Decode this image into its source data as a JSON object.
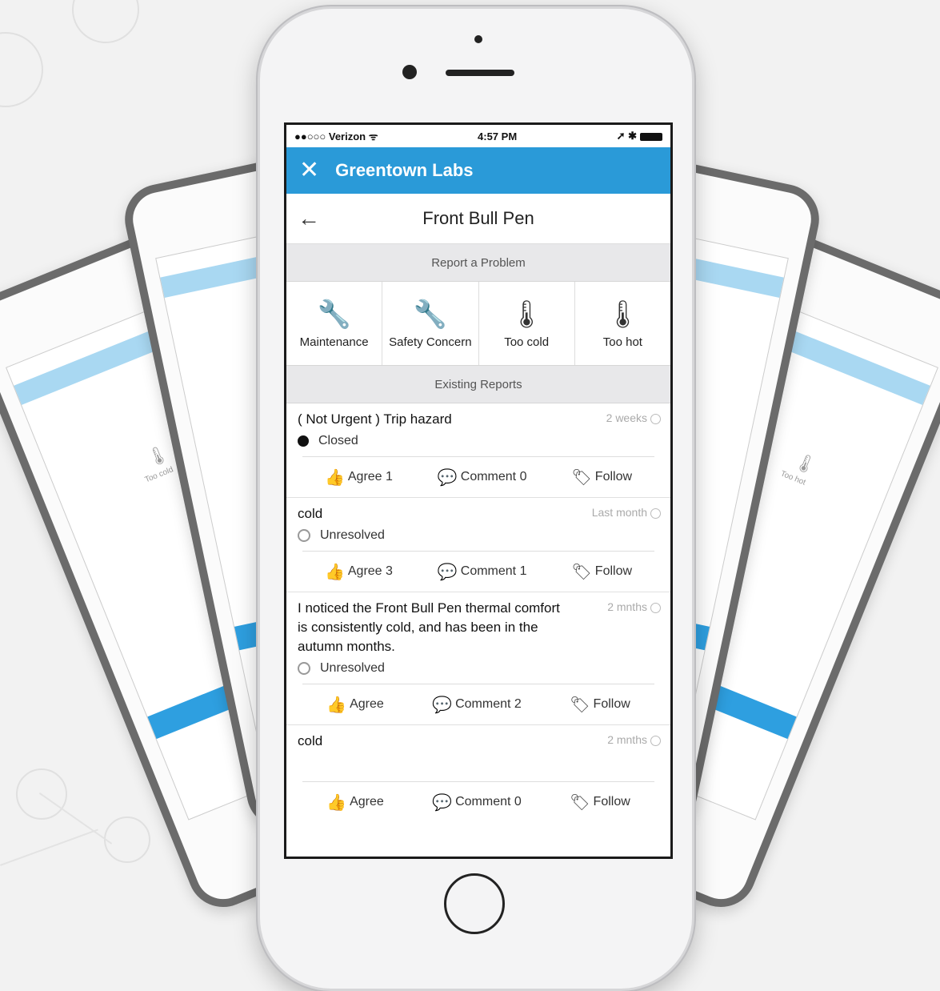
{
  "status_bar": {
    "carrier": "●●○○○ Verizon ᯤ",
    "time": "4:57 PM",
    "indicators": "➚ ✱"
  },
  "app_bar": {
    "close_icon": "✕",
    "title": "Greentown Labs"
  },
  "nav_bar": {
    "back_icon": "←",
    "title": "Front Bull Pen"
  },
  "report_section": {
    "title": "Report a Problem"
  },
  "categories": [
    {
      "icon": "wrench-icon",
      "glyph": "🔧",
      "label": "Maintenance"
    },
    {
      "icon": "wrench-icon",
      "glyph": "🔧",
      "label": "Safety Concern"
    },
    {
      "icon": "thermometer-icon",
      "glyph": "🌡",
      "label": "Too cold"
    },
    {
      "icon": "thermometer-icon",
      "glyph": "🌡",
      "label": "Too hot"
    }
  ],
  "existing_section": {
    "title": "Existing Reports"
  },
  "reports": [
    {
      "title": "( Not Urgent ) Trip hazard",
      "time": "2 weeks",
      "status": "Closed",
      "status_closed": true,
      "agree": "Agree 1",
      "comment": "Comment 0",
      "follow": "Follow"
    },
    {
      "title": "cold",
      "time": "Last month",
      "status": "Unresolved",
      "status_closed": false,
      "agree": "Agree 3",
      "comment": "Comment 1",
      "follow": "Follow"
    },
    {
      "title": "I noticed the Front Bull Pen thermal comfort is consistently cold, and has been in the autumn months.",
      "time": "2 mnths",
      "status": "Unresolved",
      "status_closed": false,
      "agree": "Agree",
      "comment": "Comment 2",
      "follow": "Follow"
    },
    {
      "title": "cold",
      "time": "2 mnths",
      "status": "",
      "status_closed": false,
      "agree": "Agree",
      "comment": "Comment 0",
      "follow": "Follow"
    }
  ],
  "background_phones": {
    "label_left": "Too cold",
    "label_right": "Too hot"
  },
  "colors": {
    "accent": "#2a9ad8",
    "section_bg": "#e8e8ea"
  }
}
